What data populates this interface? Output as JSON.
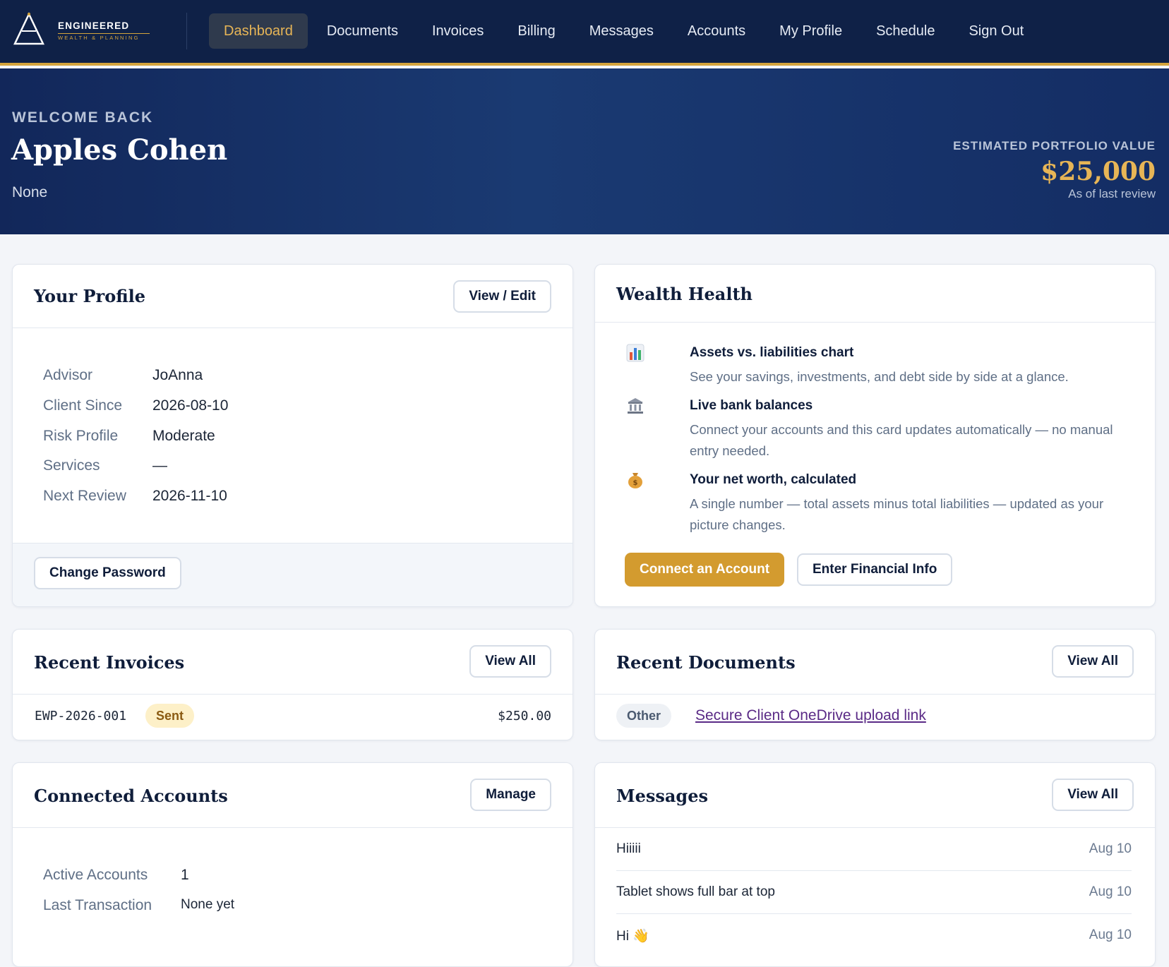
{
  "nav": {
    "logo_name": "ENGINEERED",
    "logo_sub": "WEALTH & PLANNING",
    "items": [
      {
        "label": "Dashboard"
      },
      {
        "label": "Documents"
      },
      {
        "label": "Invoices"
      },
      {
        "label": "Billing"
      },
      {
        "label": "Messages"
      },
      {
        "label": "Accounts"
      },
      {
        "label": "My Profile"
      },
      {
        "label": "Schedule"
      },
      {
        "label": "Sign Out"
      }
    ],
    "active": "Dashboard"
  },
  "hero": {
    "eyebrow": "WELCOME BACK",
    "name": "Apples Cohen",
    "subtitle": "None",
    "portfolio_label": "ESTIMATED PORTFOLIO VALUE",
    "portfolio_value": "$25,000",
    "portfolio_note": "As of last review"
  },
  "profile": {
    "title": "Your Profile",
    "edit_label": "View / Edit",
    "rows": [
      {
        "key": "Advisor",
        "value": "JoAnna"
      },
      {
        "key": "Client Since",
        "value": "2026-08-10"
      },
      {
        "key": "Risk Profile",
        "value": "Moderate"
      },
      {
        "key": "Services",
        "value": "—"
      },
      {
        "key": "Next Review",
        "value": "2026-11-10"
      }
    ],
    "change_password_label": "Change Password"
  },
  "wealth": {
    "title": "Wealth Health",
    "features": [
      {
        "icon": "bar-chart-icon",
        "title": "Assets vs. liabilities chart",
        "desc": "See your savings, investments, and debt side by side at a glance."
      },
      {
        "icon": "bank-icon",
        "title": "Live bank balances",
        "desc": "Connect your accounts and this card updates automatically — no manual entry needed."
      },
      {
        "icon": "money-bag-icon",
        "title": "Your net worth, calculated",
        "desc": "A single number — total assets minus total liabilities — updated as your picture changes."
      }
    ],
    "connect_label": "Connect an Account",
    "enter_label": "Enter Financial Info"
  },
  "invoices": {
    "title": "Recent Invoices",
    "view_all_label": "View All",
    "items": [
      {
        "number": "EWP-2026-001",
        "status": "Sent",
        "amount": "$250.00"
      }
    ]
  },
  "documents": {
    "title": "Recent Documents",
    "view_all_label": "View All",
    "items": [
      {
        "category": "Other",
        "name": "Secure Client OneDrive upload link"
      }
    ]
  },
  "accounts": {
    "title": "Connected Accounts",
    "manage_label": "Manage",
    "rows": [
      {
        "key": "Active Accounts",
        "value": "1"
      },
      {
        "key": "Last Transaction",
        "value": "None yet"
      }
    ]
  },
  "messages": {
    "title": "Messages",
    "view_all_label": "View All",
    "items": [
      {
        "text": "Hiiiii",
        "date": "Aug 10"
      },
      {
        "text": "Tablet shows full bar at top",
        "date": "Aug 10"
      },
      {
        "text": "Hi 👋",
        "date": "Aug 10"
      }
    ]
  },
  "colors": {
    "navy": "#0f2147",
    "gold": "#d4a43c",
    "accent_button": "#d39b2f"
  }
}
